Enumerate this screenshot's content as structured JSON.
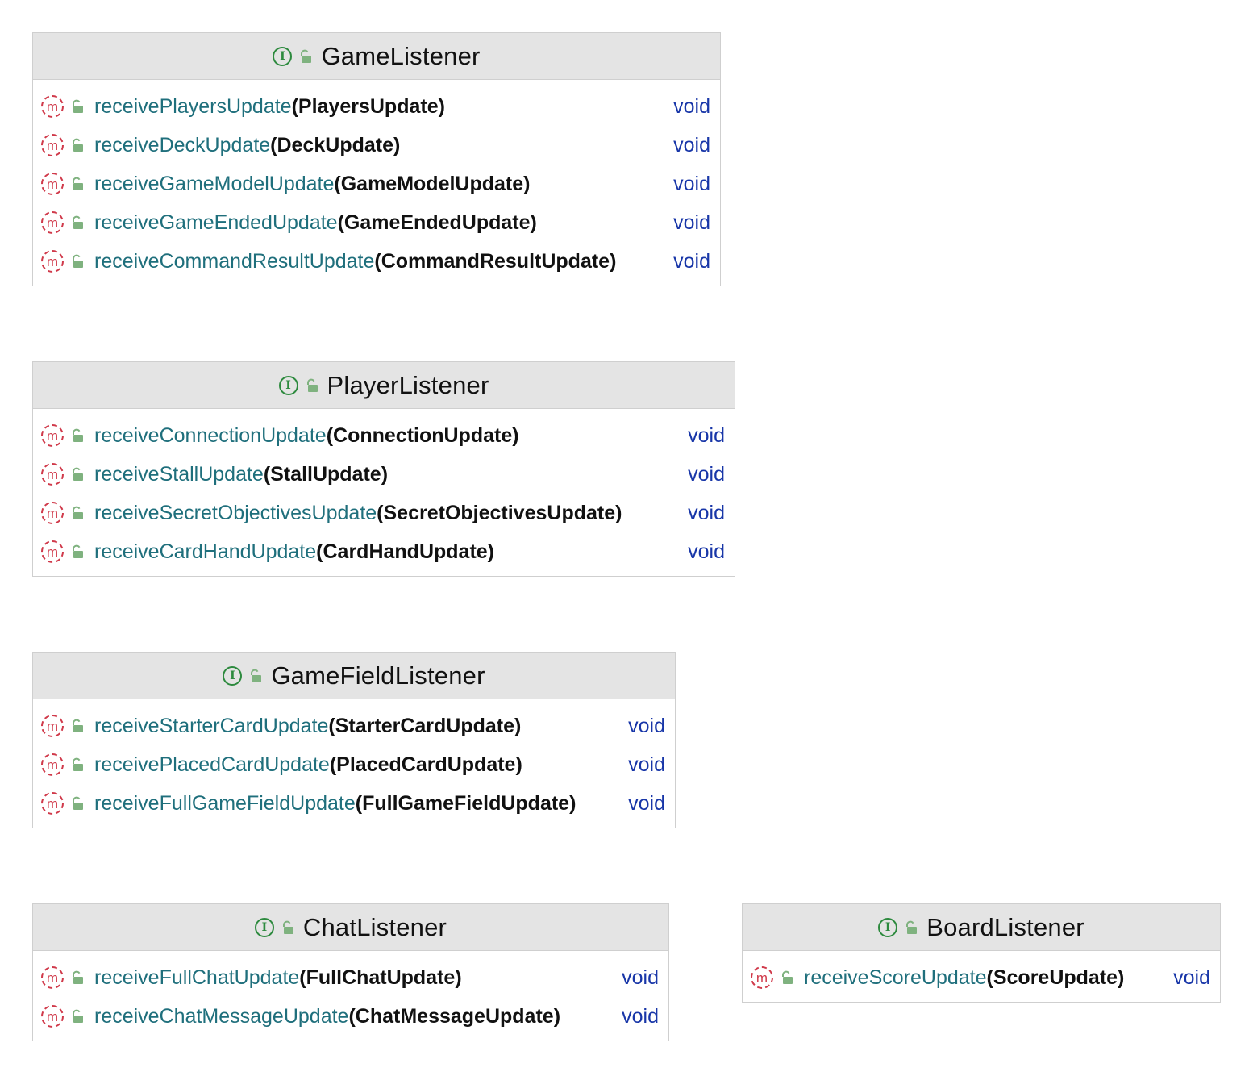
{
  "boxes": [
    {
      "name": "GameListener",
      "methods": [
        {
          "name": "receivePlayersUpdate",
          "params": "(PlayersUpdate)",
          "returns": "void"
        },
        {
          "name": "receiveDeckUpdate",
          "params": "(DeckUpdate)",
          "returns": "void"
        },
        {
          "name": "receiveGameModelUpdate",
          "params": "(GameModelUpdate)",
          "returns": "void"
        },
        {
          "name": "receiveGameEndedUpdate",
          "params": "(GameEndedUpdate)",
          "returns": "void"
        },
        {
          "name": "receiveCommandResultUpdate",
          "params": "(CommandResultUpdate)",
          "returns": "void"
        }
      ]
    },
    {
      "name": "PlayerListener",
      "methods": [
        {
          "name": "receiveConnectionUpdate",
          "params": "(ConnectionUpdate)",
          "returns": "void"
        },
        {
          "name": "receiveStallUpdate",
          "params": "(StallUpdate)",
          "returns": "void"
        },
        {
          "name": "receiveSecretObjectivesUpdate",
          "params": "(SecretObjectivesUpdate)",
          "returns": "void"
        },
        {
          "name": "receiveCardHandUpdate",
          "params": "(CardHandUpdate)",
          "returns": "void"
        }
      ]
    },
    {
      "name": "GameFieldListener",
      "methods": [
        {
          "name": "receiveStarterCardUpdate",
          "params": "(StarterCardUpdate)",
          "returns": "void"
        },
        {
          "name": "receivePlacedCardUpdate",
          "params": "(PlacedCardUpdate)",
          "returns": "void"
        },
        {
          "name": "receiveFullGameFieldUpdate",
          "params": "(FullGameFieldUpdate)",
          "returns": "void"
        }
      ]
    },
    {
      "name": "ChatListener",
      "methods": [
        {
          "name": "receiveFullChatUpdate",
          "params": "(FullChatUpdate)",
          "returns": "void"
        },
        {
          "name": "receiveChatMessageUpdate",
          "params": "(ChatMessageUpdate)",
          "returns": "void"
        }
      ]
    },
    {
      "name": "BoardListener",
      "methods": [
        {
          "name": "receiveScoreUpdate",
          "params": "(ScoreUpdate)",
          "returns": "void"
        }
      ]
    }
  ],
  "icons": {
    "interface": "interface-icon",
    "method": "method-icon",
    "visibility": "public-lock-icon"
  },
  "colors": {
    "interface_icon": "#2d8a3e",
    "method_icon": "#d0394a",
    "method_name": "#1f6f7c",
    "return_type": "#1836a8",
    "header_bg": "#e4e4e4",
    "border": "#cfcfcf"
  }
}
